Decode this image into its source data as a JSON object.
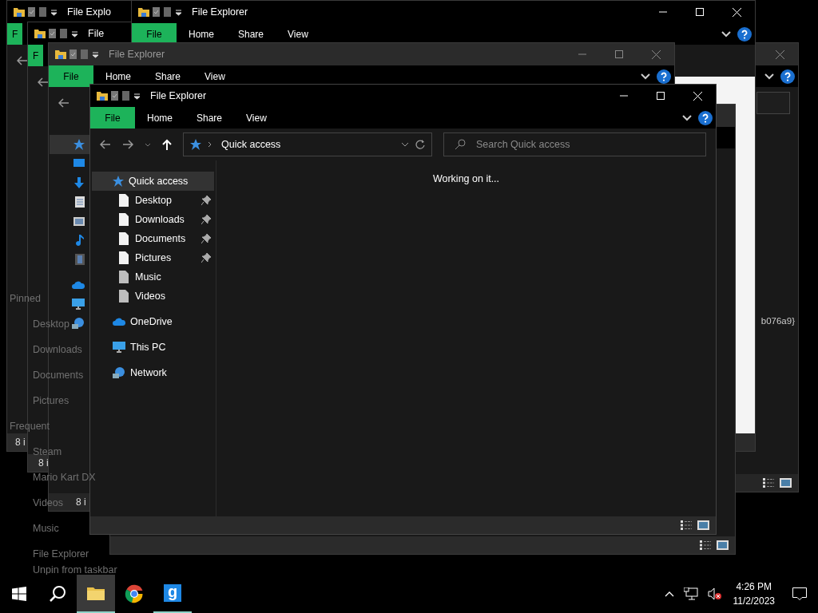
{
  "windows": [
    {
      "title": "File Explo",
      "focused": true,
      "tabs": [
        {
          "label": "F",
          "kind": "file"
        }
      ],
      "status": "8 i"
    },
    {
      "title": "File",
      "focused": true,
      "tabs": [
        {
          "label": "F",
          "kind": "file"
        }
      ],
      "status": "8 i"
    },
    {
      "focused": false,
      "note": "b076a9}"
    },
    {
      "title": "File Explorer",
      "focused": true,
      "tabs": [
        {
          "label": "File",
          "kind": "file"
        },
        {
          "label": "Home",
          "kind": "tab"
        },
        {
          "label": "Share",
          "kind": "tab"
        },
        {
          "label": "View",
          "kind": "tab"
        }
      ]
    },
    {
      "title": "File Explorer",
      "focused": false,
      "tabs": [
        {
          "label": "File",
          "kind": "file"
        },
        {
          "label": "Home",
          "kind": "tab"
        },
        {
          "label": "Share",
          "kind": "tab"
        },
        {
          "label": "View",
          "kind": "tab"
        }
      ],
      "status": "8 i",
      "nav": [
        {
          "selected": true
        },
        {
          "selected": false
        },
        {
          "selected": false
        },
        {
          "selected": false
        },
        {
          "selected": false
        },
        {
          "selected": false
        },
        {
          "selected": false
        },
        {
          "selected": false
        },
        {
          "selected": false
        },
        {
          "selected": false
        }
      ]
    }
  ],
  "front": {
    "title": "File Explorer",
    "focused": true,
    "tabs": [
      {
        "label": "File",
        "kind": "file"
      },
      {
        "label": "Home",
        "kind": "tab"
      },
      {
        "label": "Share",
        "kind": "tab"
      },
      {
        "label": "View",
        "kind": "tab"
      }
    ],
    "address": "Quick access",
    "search": {
      "placeholder": "Search Quick access"
    },
    "nav": [
      {
        "label": "Quick access",
        "selected": true,
        "children": [
          {
            "label": "Desktop",
            "pinned": true,
            "selected": false
          },
          {
            "label": "Downloads",
            "pinned": true,
            "selected": false
          },
          {
            "label": "Documents",
            "pinned": true,
            "selected": false
          },
          {
            "label": "Pictures",
            "pinned": true,
            "selected": false
          },
          {
            "label": "Music",
            "pinned": false,
            "selected": false
          },
          {
            "label": "Videos",
            "pinned": false,
            "selected": false
          }
        ]
      },
      {
        "label": "OneDrive",
        "selected": false
      },
      {
        "label": "This PC",
        "selected": false
      },
      {
        "label": "Network",
        "selected": false
      }
    ],
    "status": "Working on it..."
  },
  "jump_list": [
    {
      "label": "Pinned",
      "kind": "heading"
    },
    {
      "label": "Desktop",
      "kind": "item"
    },
    {
      "label": "Downloads",
      "kind": "item"
    },
    {
      "label": "Documents",
      "kind": "item"
    },
    {
      "label": "Pictures",
      "kind": "item"
    },
    {
      "label": "Frequent",
      "kind": "heading"
    },
    {
      "label": "Steam",
      "kind": "item"
    },
    {
      "label": "Mario Kart DX",
      "kind": "item"
    },
    {
      "label": "Videos",
      "kind": "item"
    },
    {
      "label": "Music",
      "kind": "item"
    },
    {
      "label": "File Explorer",
      "kind": "app"
    },
    {
      "label": "Unpin from taskbar",
      "kind": "action"
    }
  ],
  "taskbar": {
    "apps": [
      {
        "active": true,
        "running": true
      },
      {
        "active": false,
        "running": false
      },
      {
        "label": "g",
        "active": false,
        "running": true
      }
    ],
    "volume_muted": true,
    "time": "4:26 PM",
    "date": "11/2/2023"
  }
}
